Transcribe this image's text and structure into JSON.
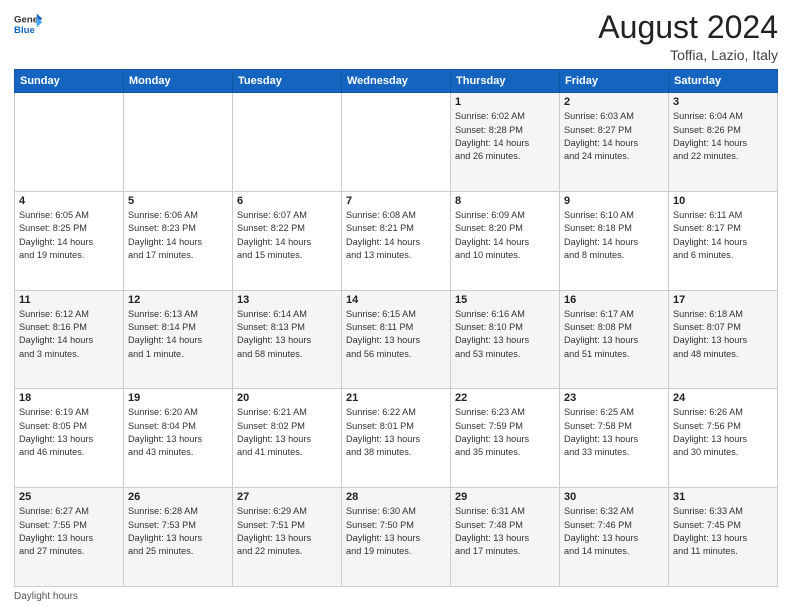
{
  "header": {
    "logo_general": "General",
    "logo_blue": "Blue",
    "month_year": "August 2024",
    "location": "Toffia, Lazio, Italy"
  },
  "days_of_week": [
    "Sunday",
    "Monday",
    "Tuesday",
    "Wednesday",
    "Thursday",
    "Friday",
    "Saturday"
  ],
  "weeks": [
    [
      {
        "day": "",
        "info": ""
      },
      {
        "day": "",
        "info": ""
      },
      {
        "day": "",
        "info": ""
      },
      {
        "day": "",
        "info": ""
      },
      {
        "day": "1",
        "info": "Sunrise: 6:02 AM\nSunset: 8:28 PM\nDaylight: 14 hours\nand 26 minutes."
      },
      {
        "day": "2",
        "info": "Sunrise: 6:03 AM\nSunset: 8:27 PM\nDaylight: 14 hours\nand 24 minutes."
      },
      {
        "day": "3",
        "info": "Sunrise: 6:04 AM\nSunset: 8:26 PM\nDaylight: 14 hours\nand 22 minutes."
      }
    ],
    [
      {
        "day": "4",
        "info": "Sunrise: 6:05 AM\nSunset: 8:25 PM\nDaylight: 14 hours\nand 19 minutes."
      },
      {
        "day": "5",
        "info": "Sunrise: 6:06 AM\nSunset: 8:23 PM\nDaylight: 14 hours\nand 17 minutes."
      },
      {
        "day": "6",
        "info": "Sunrise: 6:07 AM\nSunset: 8:22 PM\nDaylight: 14 hours\nand 15 minutes."
      },
      {
        "day": "7",
        "info": "Sunrise: 6:08 AM\nSunset: 8:21 PM\nDaylight: 14 hours\nand 13 minutes."
      },
      {
        "day": "8",
        "info": "Sunrise: 6:09 AM\nSunset: 8:20 PM\nDaylight: 14 hours\nand 10 minutes."
      },
      {
        "day": "9",
        "info": "Sunrise: 6:10 AM\nSunset: 8:18 PM\nDaylight: 14 hours\nand 8 minutes."
      },
      {
        "day": "10",
        "info": "Sunrise: 6:11 AM\nSunset: 8:17 PM\nDaylight: 14 hours\nand 6 minutes."
      }
    ],
    [
      {
        "day": "11",
        "info": "Sunrise: 6:12 AM\nSunset: 8:16 PM\nDaylight: 14 hours\nand 3 minutes."
      },
      {
        "day": "12",
        "info": "Sunrise: 6:13 AM\nSunset: 8:14 PM\nDaylight: 14 hours\nand 1 minute."
      },
      {
        "day": "13",
        "info": "Sunrise: 6:14 AM\nSunset: 8:13 PM\nDaylight: 13 hours\nand 58 minutes."
      },
      {
        "day": "14",
        "info": "Sunrise: 6:15 AM\nSunset: 8:11 PM\nDaylight: 13 hours\nand 56 minutes."
      },
      {
        "day": "15",
        "info": "Sunrise: 6:16 AM\nSunset: 8:10 PM\nDaylight: 13 hours\nand 53 minutes."
      },
      {
        "day": "16",
        "info": "Sunrise: 6:17 AM\nSunset: 8:08 PM\nDaylight: 13 hours\nand 51 minutes."
      },
      {
        "day": "17",
        "info": "Sunrise: 6:18 AM\nSunset: 8:07 PM\nDaylight: 13 hours\nand 48 minutes."
      }
    ],
    [
      {
        "day": "18",
        "info": "Sunrise: 6:19 AM\nSunset: 8:05 PM\nDaylight: 13 hours\nand 46 minutes."
      },
      {
        "day": "19",
        "info": "Sunrise: 6:20 AM\nSunset: 8:04 PM\nDaylight: 13 hours\nand 43 minutes."
      },
      {
        "day": "20",
        "info": "Sunrise: 6:21 AM\nSunset: 8:02 PM\nDaylight: 13 hours\nand 41 minutes."
      },
      {
        "day": "21",
        "info": "Sunrise: 6:22 AM\nSunset: 8:01 PM\nDaylight: 13 hours\nand 38 minutes."
      },
      {
        "day": "22",
        "info": "Sunrise: 6:23 AM\nSunset: 7:59 PM\nDaylight: 13 hours\nand 35 minutes."
      },
      {
        "day": "23",
        "info": "Sunrise: 6:25 AM\nSunset: 7:58 PM\nDaylight: 13 hours\nand 33 minutes."
      },
      {
        "day": "24",
        "info": "Sunrise: 6:26 AM\nSunset: 7:56 PM\nDaylight: 13 hours\nand 30 minutes."
      }
    ],
    [
      {
        "day": "25",
        "info": "Sunrise: 6:27 AM\nSunset: 7:55 PM\nDaylight: 13 hours\nand 27 minutes."
      },
      {
        "day": "26",
        "info": "Sunrise: 6:28 AM\nSunset: 7:53 PM\nDaylight: 13 hours\nand 25 minutes."
      },
      {
        "day": "27",
        "info": "Sunrise: 6:29 AM\nSunset: 7:51 PM\nDaylight: 13 hours\nand 22 minutes."
      },
      {
        "day": "28",
        "info": "Sunrise: 6:30 AM\nSunset: 7:50 PM\nDaylight: 13 hours\nand 19 minutes."
      },
      {
        "day": "29",
        "info": "Sunrise: 6:31 AM\nSunset: 7:48 PM\nDaylight: 13 hours\nand 17 minutes."
      },
      {
        "day": "30",
        "info": "Sunrise: 6:32 AM\nSunset: 7:46 PM\nDaylight: 13 hours\nand 14 minutes."
      },
      {
        "day": "31",
        "info": "Sunrise: 6:33 AM\nSunset: 7:45 PM\nDaylight: 13 hours\nand 11 minutes."
      }
    ]
  ],
  "footer": {
    "note": "Daylight hours"
  }
}
